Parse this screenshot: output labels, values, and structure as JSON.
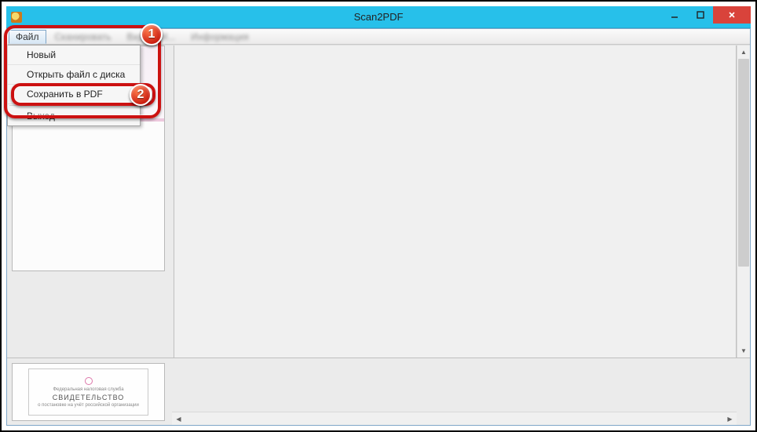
{
  "window": {
    "title": "Scan2PDF"
  },
  "menubar": {
    "file": "Файл",
    "scan": "Сканировать",
    "view": "Вид",
    "mark": "М...",
    "info": "Информация"
  },
  "file_menu": {
    "new": "Новый",
    "open": "Открыть файл с диска",
    "save_pdf": "Сохранить в PDF",
    "exit": "Выход"
  },
  "badges": {
    "one": "1",
    "two": "2"
  },
  "certificate": {
    "line1": "Федеральная налоговая служба",
    "title": "СВИДЕТЕЛЬСТВО",
    "line2": "о постановке на учёт российской организации"
  }
}
